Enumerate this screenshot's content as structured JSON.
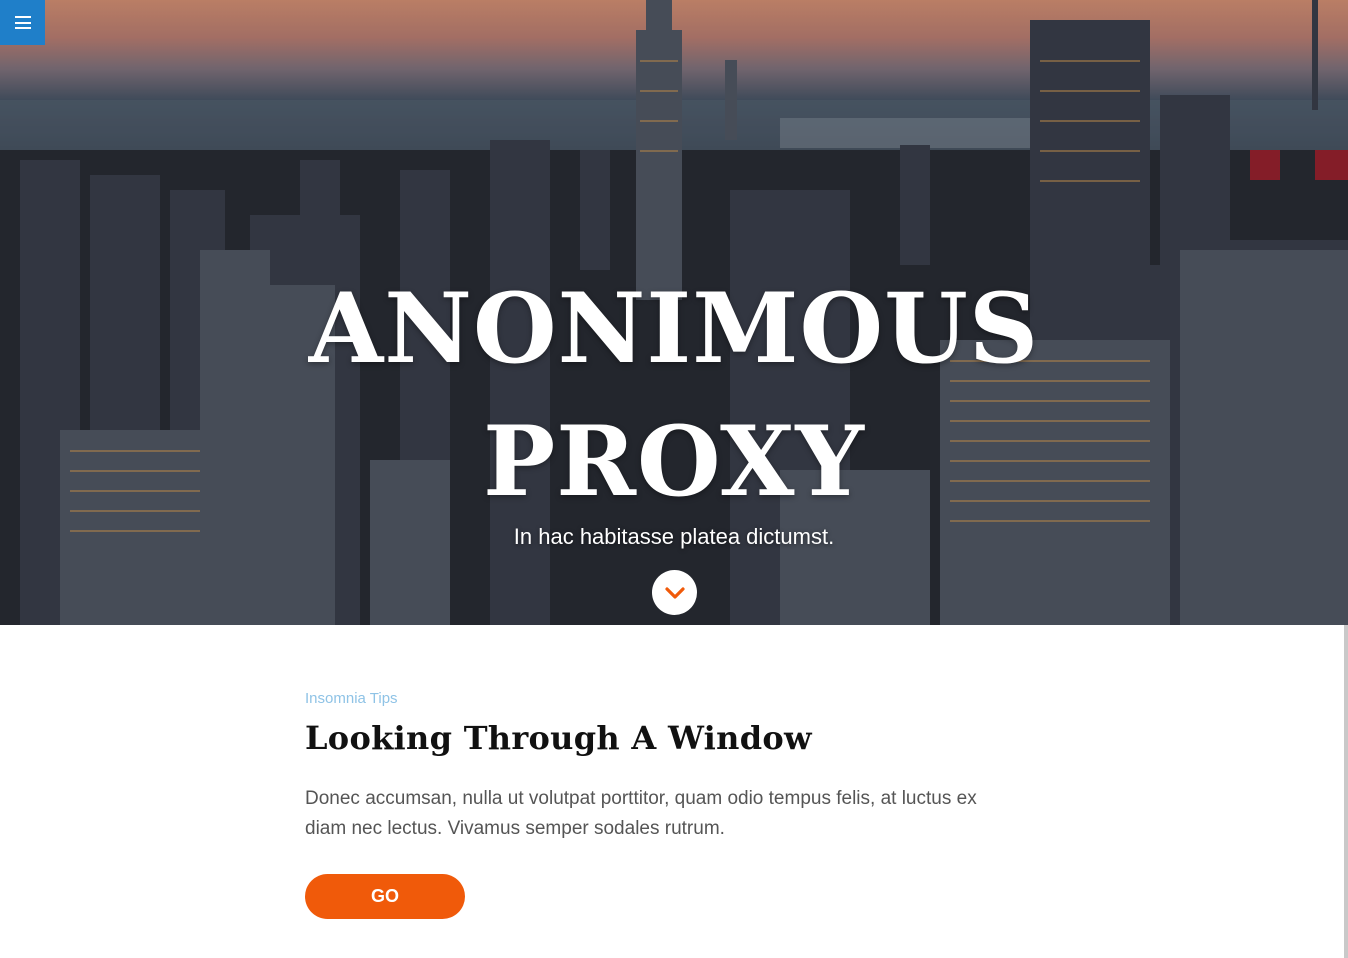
{
  "menu": {
    "icon": "hamburger-menu-icon",
    "color": "#1f7fc9"
  },
  "hero": {
    "title_line1": "ANONIMOUS",
    "title_line2": "PROXY",
    "subtitle": "In hac habitasse platea dictumst.",
    "scroll_icon": "chevron-down-icon"
  },
  "post": {
    "category": "Insomnia Tips",
    "title": "Looking Through A Window",
    "text": "Donec accumsan, nulla ut volutpat porttitor, quam odio tempus felis, at luctus ex diam nec lectus. Vivamus semper sodales rutrum.",
    "button_label": "GO"
  },
  "colors": {
    "accent": "#f05a0a",
    "category": "#8fc3e6",
    "menu_bg": "#1f7fc9"
  }
}
